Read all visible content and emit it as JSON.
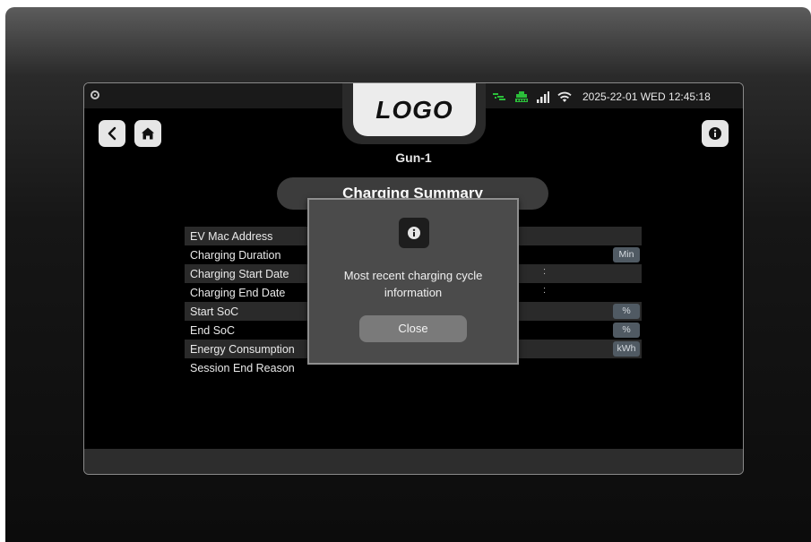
{
  "header": {
    "logo_text": "LOGO",
    "datetime": "2025-22-01 WED 12:45:18"
  },
  "status_icons": [
    "charging-plug-icon",
    "ethernet-icon",
    "signal-bars-icon",
    "wifi-icon"
  ],
  "colors": {
    "accent_green": "#2bbf3a",
    "unit_badge": "#505a63",
    "modal_bg": "#4b4b4b"
  },
  "gun_label": "Gun-1",
  "summary_title": "Charging Summary",
  "table": {
    "rows": [
      {
        "label": "EV Mac Address",
        "unit": "",
        "colon": ""
      },
      {
        "label": "Charging Duration",
        "unit": "Min",
        "colon": ""
      },
      {
        "label": "Charging Start Date",
        "unit": "",
        "colon": ":"
      },
      {
        "label": "Charging End Date",
        "unit": "",
        "colon": ":"
      },
      {
        "label": "Start SoC",
        "unit": "%",
        "colon": ""
      },
      {
        "label": "End SoC",
        "unit": "%",
        "colon": ""
      },
      {
        "label": "Energy Consumption",
        "unit": "kWh",
        "colon": ""
      },
      {
        "label": "Session End Reason",
        "unit": "",
        "colon": ""
      }
    ]
  },
  "modal": {
    "message": "Most recent charging cycle information",
    "close_label": "Close"
  }
}
